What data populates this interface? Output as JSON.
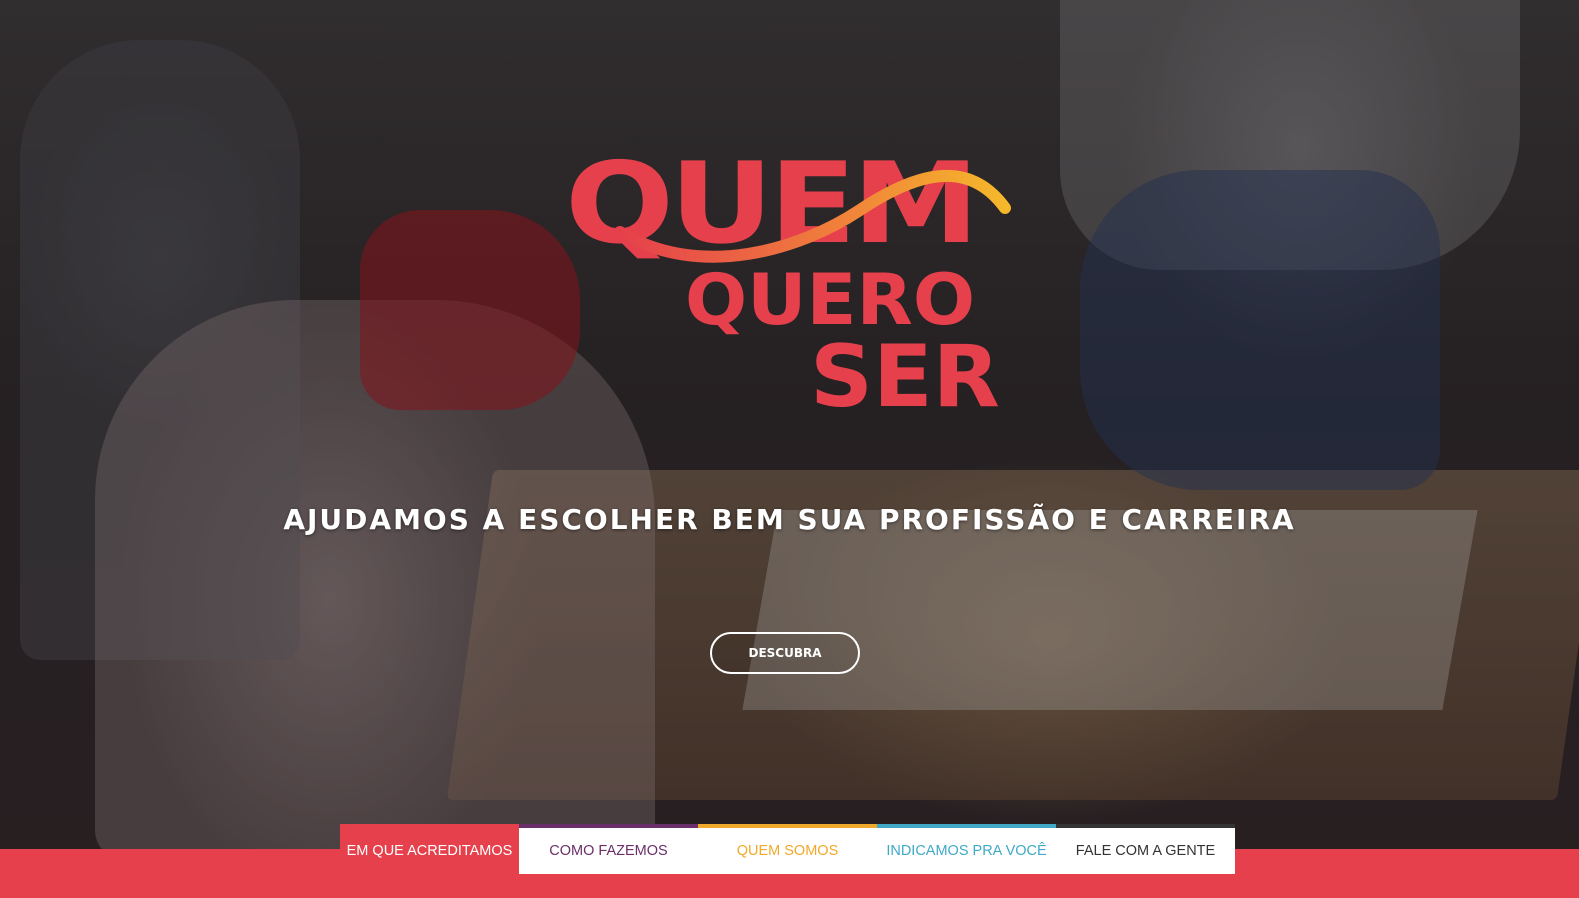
{
  "logo": {
    "line1": "QUEM",
    "line2": "QUERO",
    "line3": "SER",
    "colors": {
      "red": "#e5404c",
      "orange": "#f07e3c",
      "yellow": "#f5b82a"
    }
  },
  "hero": {
    "tagline": "AJUDAMOS A ESCOLHER BEM SUA PROFISSÃO E CARREIRA",
    "cta_label": "DESCUBRA"
  },
  "nav": {
    "items": [
      {
        "label": "EM QUE ACREDITAMOS",
        "color": "#ffffff",
        "accent": "#e5404c",
        "active": true
      },
      {
        "label": "COMO FAZEMOS",
        "color": "#6a2e68",
        "accent": "#6a2e68",
        "active": false
      },
      {
        "label": "QUEM SOMOS",
        "color": "#f0a92a",
        "accent": "#f0a92a",
        "active": false
      },
      {
        "label": "INDICAMOS PRA VOCÊ",
        "color": "#3fa9c6",
        "accent": "#3fa9c6",
        "active": false
      },
      {
        "label": "FALE COM A GENTE",
        "color": "#333333",
        "accent": "#333333",
        "active": false
      }
    ]
  },
  "colors": {
    "brand": "#e5404c"
  }
}
